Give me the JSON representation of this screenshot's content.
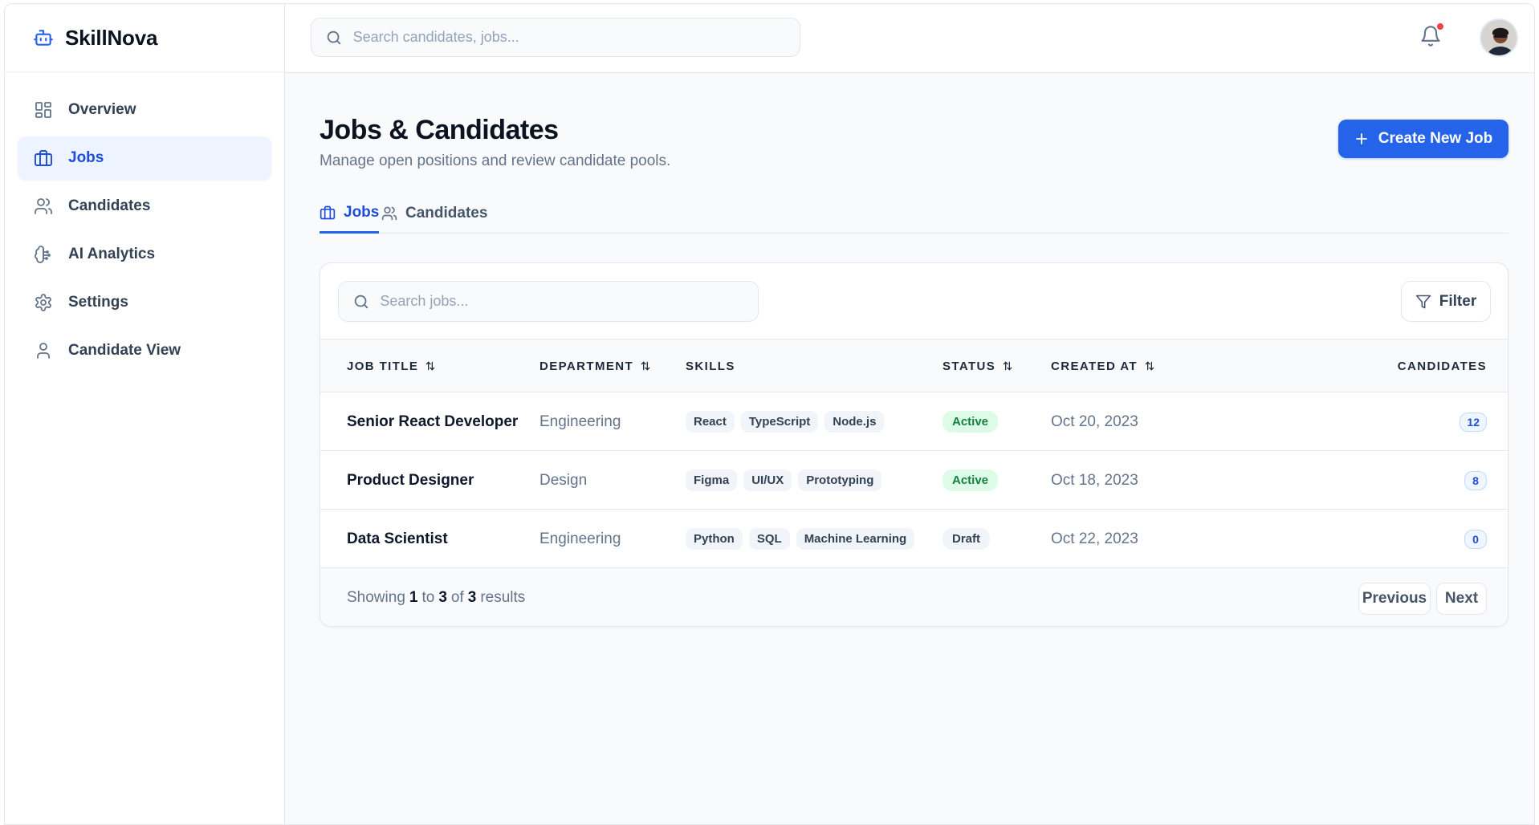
{
  "brand": {
    "name": "SkillNova",
    "icon": "bot-icon"
  },
  "sidebar": {
    "items": [
      {
        "label": "Overview",
        "icon": "layout-grid-icon",
        "active": false
      },
      {
        "label": "Jobs",
        "icon": "briefcase-icon",
        "active": true
      },
      {
        "label": "Candidates",
        "icon": "users-icon",
        "active": false
      },
      {
        "label": "AI Analytics",
        "icon": "brain-circuit-icon",
        "active": false
      },
      {
        "label": "Settings",
        "icon": "gear-icon",
        "active": false
      },
      {
        "label": "Candidate View",
        "icon": "user-icon",
        "active": false
      }
    ]
  },
  "header": {
    "search_placeholder": "Search candidates, jobs...",
    "has_notification": true
  },
  "page": {
    "title": "Jobs & Candidates",
    "subtitle": "Manage open positions and review candidate pools.",
    "create_button": "Create New Job"
  },
  "tabs": [
    {
      "label": "Jobs",
      "icon": "briefcase-icon",
      "active": true
    },
    {
      "label": "Candidates",
      "icon": "users-icon",
      "active": false
    }
  ],
  "table": {
    "search_placeholder": "Search jobs...",
    "filter_label": "Filter",
    "columns": [
      "JOB TITLE",
      "DEPARTMENT",
      "SKILLS",
      "STATUS",
      "CREATED AT",
      "CANDIDATES"
    ],
    "rows": [
      {
        "title": "Senior React Developer",
        "department": "Engineering",
        "skills": [
          "React",
          "TypeScript",
          "Node.js"
        ],
        "status": "Active",
        "created": "Oct 20, 2023",
        "candidates": "12"
      },
      {
        "title": "Product Designer",
        "department": "Design",
        "skills": [
          "Figma",
          "UI/UX",
          "Prototyping"
        ],
        "status": "Active",
        "created": "Oct 18, 2023",
        "candidates": "8"
      },
      {
        "title": "Data Scientist",
        "department": "Engineering",
        "skills": [
          "Python",
          "SQL",
          "Machine Learning"
        ],
        "status": "Draft",
        "created": "Oct 22, 2023",
        "candidates": "0"
      }
    ],
    "footer": {
      "showing_prefix": "Showing",
      "from": "1",
      "to_word": "to",
      "to": "3",
      "of_word": "of",
      "total": "3",
      "results_word": "results",
      "previous": "Previous",
      "next": "Next"
    }
  },
  "colors": {
    "accent": "#2563eb",
    "active_bg": "#eef4ff",
    "status_active": "#15803d",
    "notification": "#ef4444"
  }
}
